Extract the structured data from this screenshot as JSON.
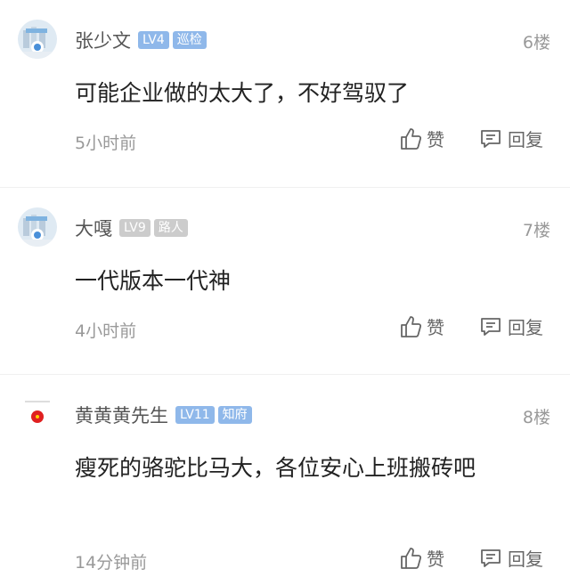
{
  "comments": [
    {
      "username": "张少文",
      "level": "LV4",
      "title": "巡检",
      "floor": "6楼",
      "text": "可能企业做的太大了，不好驾驭了",
      "time": "5小时前",
      "like_label": "赞",
      "reply_label": "回复",
      "level_color": "#8fb8ea",
      "title_color": "#8fb8ea"
    },
    {
      "username": "大嘎",
      "level": "LV9",
      "title": "路人",
      "floor": "7楼",
      "text": "一代版本一代神",
      "time": "4小时前",
      "like_label": "赞",
      "reply_label": "回复",
      "level_color": "#cccccc",
      "title_color": "#cccccc"
    },
    {
      "username": "黄黄黄先生",
      "level": "LV11",
      "title": "知府",
      "floor": "8楼",
      "text": "瘦死的骆驼比马大，各位安心上班搬砖吧",
      "time": "14分钟前",
      "like_label": "赞",
      "reply_label": "回复",
      "level_color": "#8fb8ea",
      "title_color": "#8fb8ea"
    }
  ]
}
